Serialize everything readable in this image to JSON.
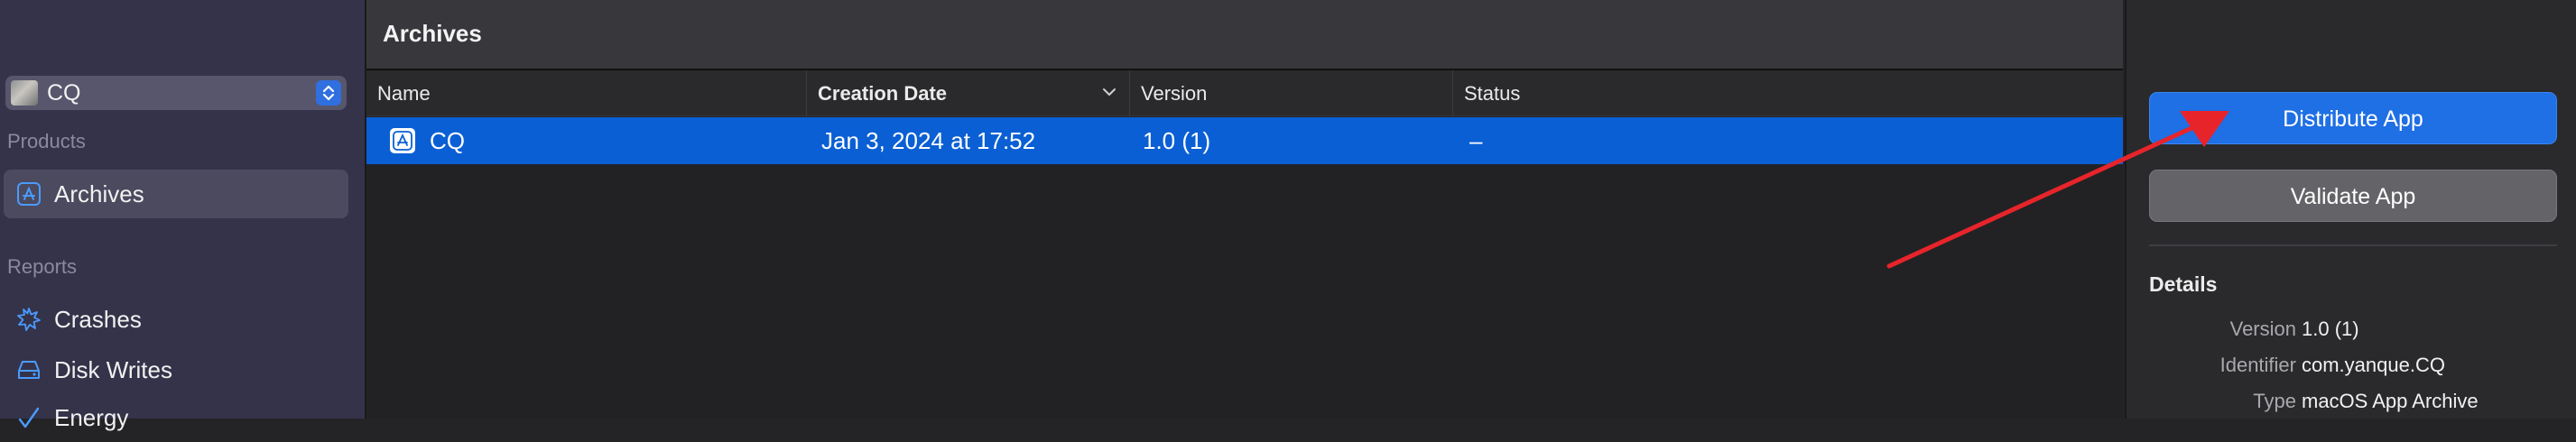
{
  "sidebar": {
    "scheme": {
      "label": "CQ"
    },
    "sections": {
      "products": "Products",
      "reports": "Reports"
    },
    "items": [
      {
        "label": "Archives",
        "icon": "app-icon",
        "selected": true
      },
      {
        "label": "Crashes",
        "icon": "crash-icon"
      },
      {
        "label": "Disk Writes",
        "icon": "disk-icon"
      },
      {
        "label": "Energy",
        "icon": "energy-icon"
      }
    ]
  },
  "main": {
    "title": "Archives",
    "columns": [
      "Name",
      "Creation Date",
      "Version",
      "Status"
    ],
    "rows": [
      {
        "name": "CQ",
        "creation_date": "Jan 3, 2024 at 17:52",
        "version": "1.0 (1)",
        "status": "–"
      }
    ]
  },
  "inspector": {
    "distribute_label": "Distribute App",
    "validate_label": "Validate App",
    "details_title": "Details",
    "details": [
      {
        "key": "Version",
        "value": "1.0 (1)"
      },
      {
        "key": "Identifier",
        "value": "com.yanque.CQ"
      },
      {
        "key": "Type",
        "value": "macOS App Archive"
      }
    ]
  },
  "colors": {
    "accent": "#1f6fe5",
    "selection": "#0b5fd4",
    "annotation_arrow": "#e8242b"
  }
}
